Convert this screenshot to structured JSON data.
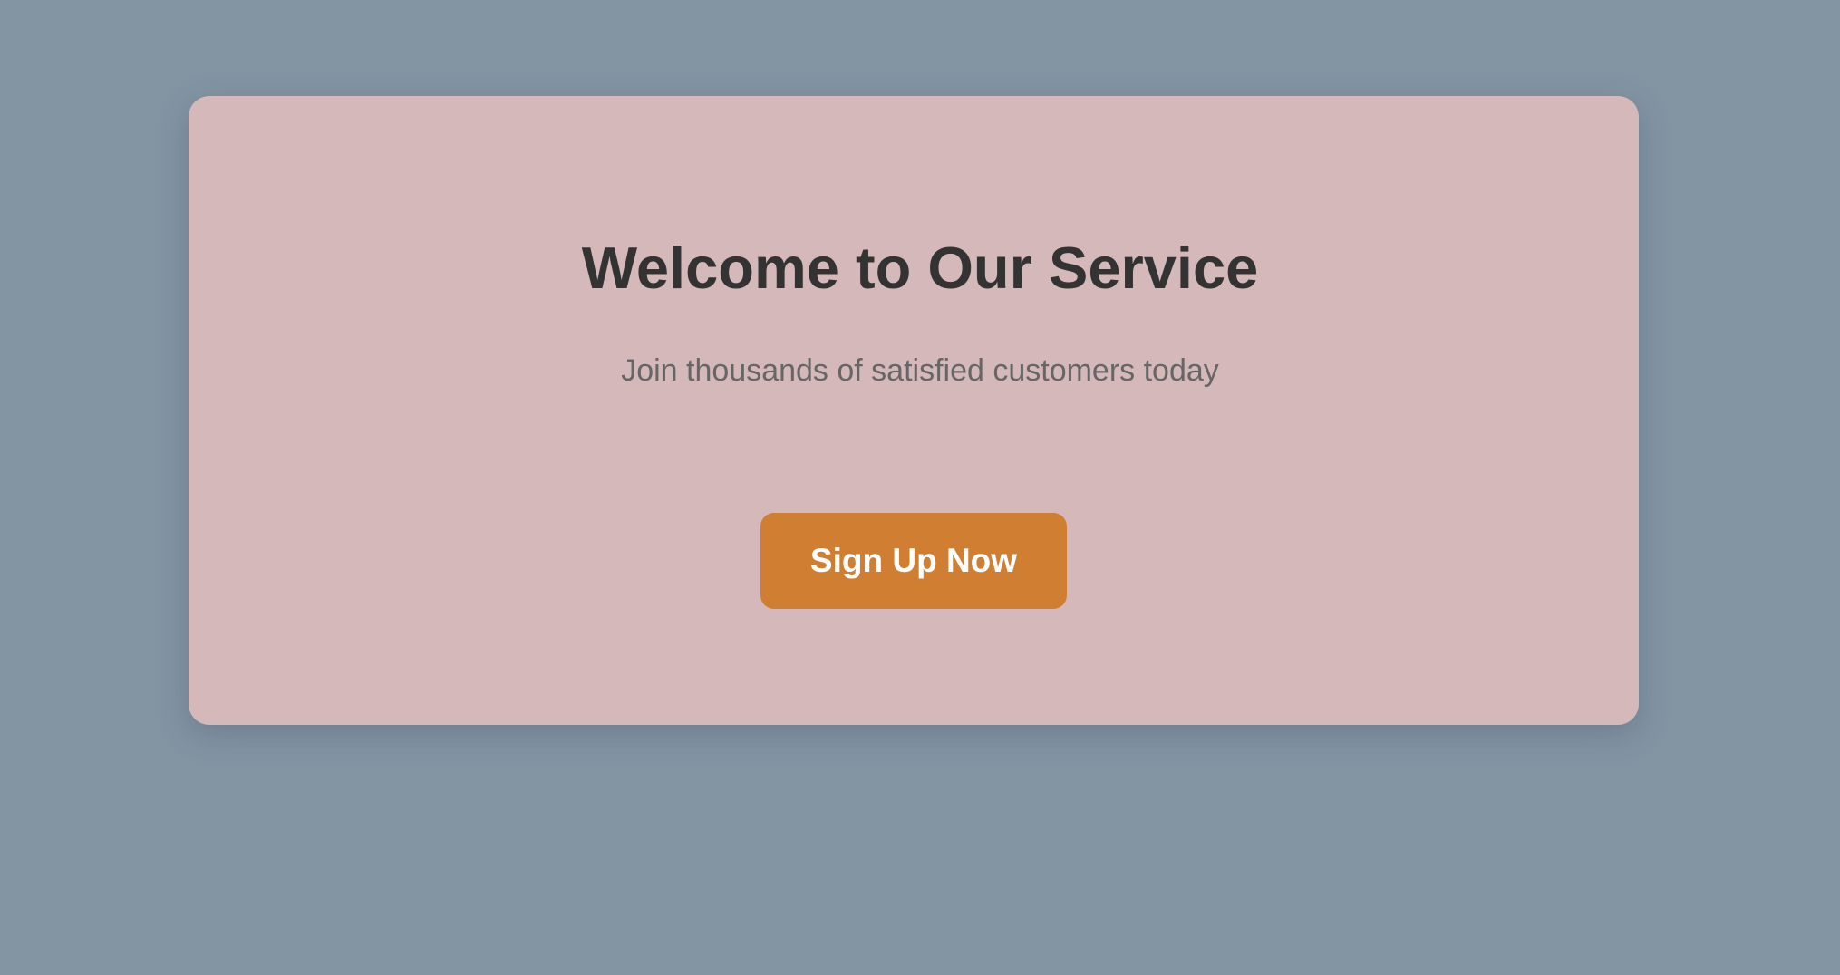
{
  "hero": {
    "title": "Welcome to Our Service",
    "subtitle": "Join thousands of satisfied customers today",
    "cta_label": "Sign Up Now"
  },
  "colors": {
    "page_background": "#8394a3",
    "card_background": "#d5b8b9",
    "title_text": "#333333",
    "subtitle_text": "#666666",
    "cta_background": "#d07f32",
    "cta_text": "#ffffff"
  }
}
